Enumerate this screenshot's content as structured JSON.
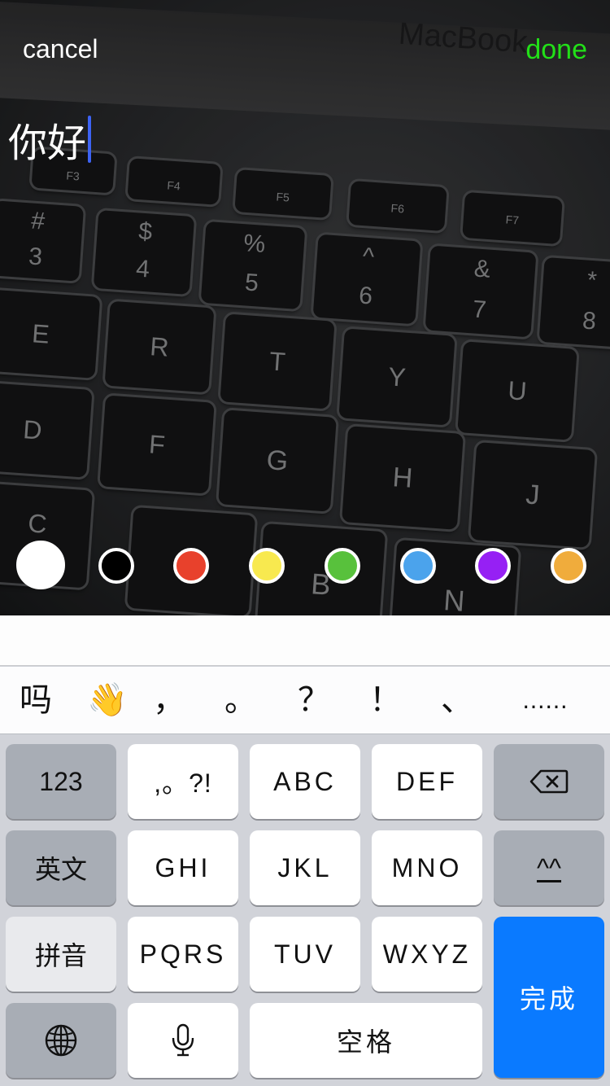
{
  "editor": {
    "cancel_label": "cancel",
    "done_label": "done",
    "text": "你好",
    "background_text": "MacBook"
  },
  "photo_keys": [
    "#",
    "3",
    "$",
    "4",
    "%",
    "5",
    "^",
    "6",
    "&",
    "7",
    "*",
    "8",
    "E",
    "R",
    "T",
    "Y",
    "U",
    "D",
    "F",
    "G",
    "H",
    "J",
    "B",
    "N",
    "C",
    "F3",
    "F4",
    "F5",
    "F6",
    "F7"
  ],
  "color_swatches": [
    {
      "name": "white",
      "color": "#ffffff",
      "selected": true
    },
    {
      "name": "black",
      "color": "#000000",
      "selected": false
    },
    {
      "name": "red",
      "color": "#e8412c",
      "selected": false
    },
    {
      "name": "yellow",
      "color": "#f8e94f",
      "selected": false
    },
    {
      "name": "green",
      "color": "#58c13c",
      "selected": false
    },
    {
      "name": "blue",
      "color": "#4ba3ec",
      "selected": false
    },
    {
      "name": "purple",
      "color": "#9620f4",
      "selected": false
    },
    {
      "name": "orange",
      "color": "#f0ac3c",
      "selected": false
    }
  ],
  "candidates": [
    "吗",
    "👋",
    "，",
    "。",
    "？",
    "！",
    "、",
    "……"
  ],
  "keyboard": {
    "row1": [
      "123",
      ",。?!",
      "ABC",
      "DEF"
    ],
    "row2": [
      "英文",
      "GHI",
      "JKL",
      "MNO",
      "^^"
    ],
    "row3": [
      "拼音",
      "PQRS",
      "TUV",
      "WXYZ"
    ],
    "row4_space": "空格",
    "return_label": "完成"
  },
  "colors": {
    "done_green": "#22e018",
    "caret_blue": "#3d63f4",
    "return_blue": "#0a7aff"
  }
}
